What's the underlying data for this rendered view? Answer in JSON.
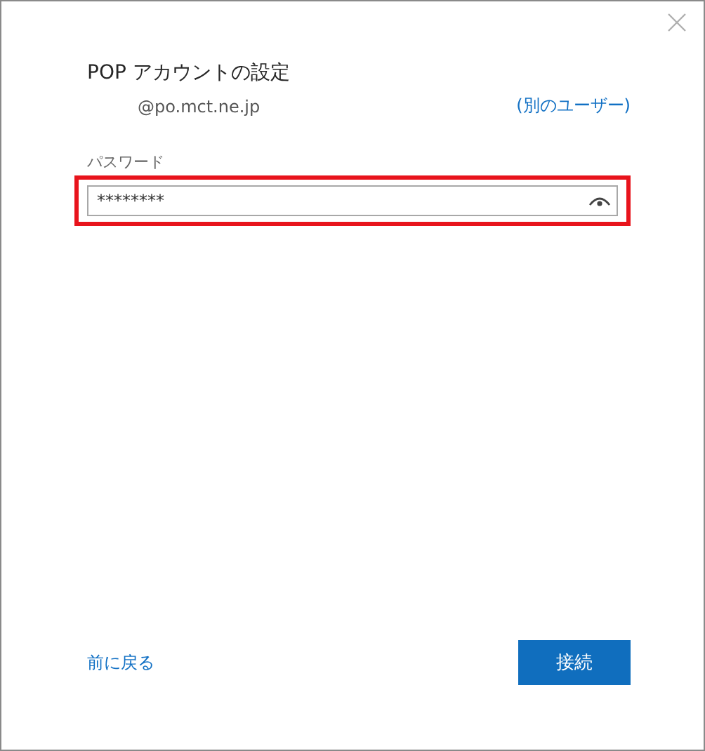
{
  "dialog": {
    "title": "POP アカウントの設定",
    "email": "@po.mct.ne.jp",
    "other_user_link": "(別のユーザー)"
  },
  "password": {
    "label": "パスワード",
    "value": "********",
    "highlighted": true
  },
  "back_link": "前に戻る",
  "connect_button": "接続"
}
